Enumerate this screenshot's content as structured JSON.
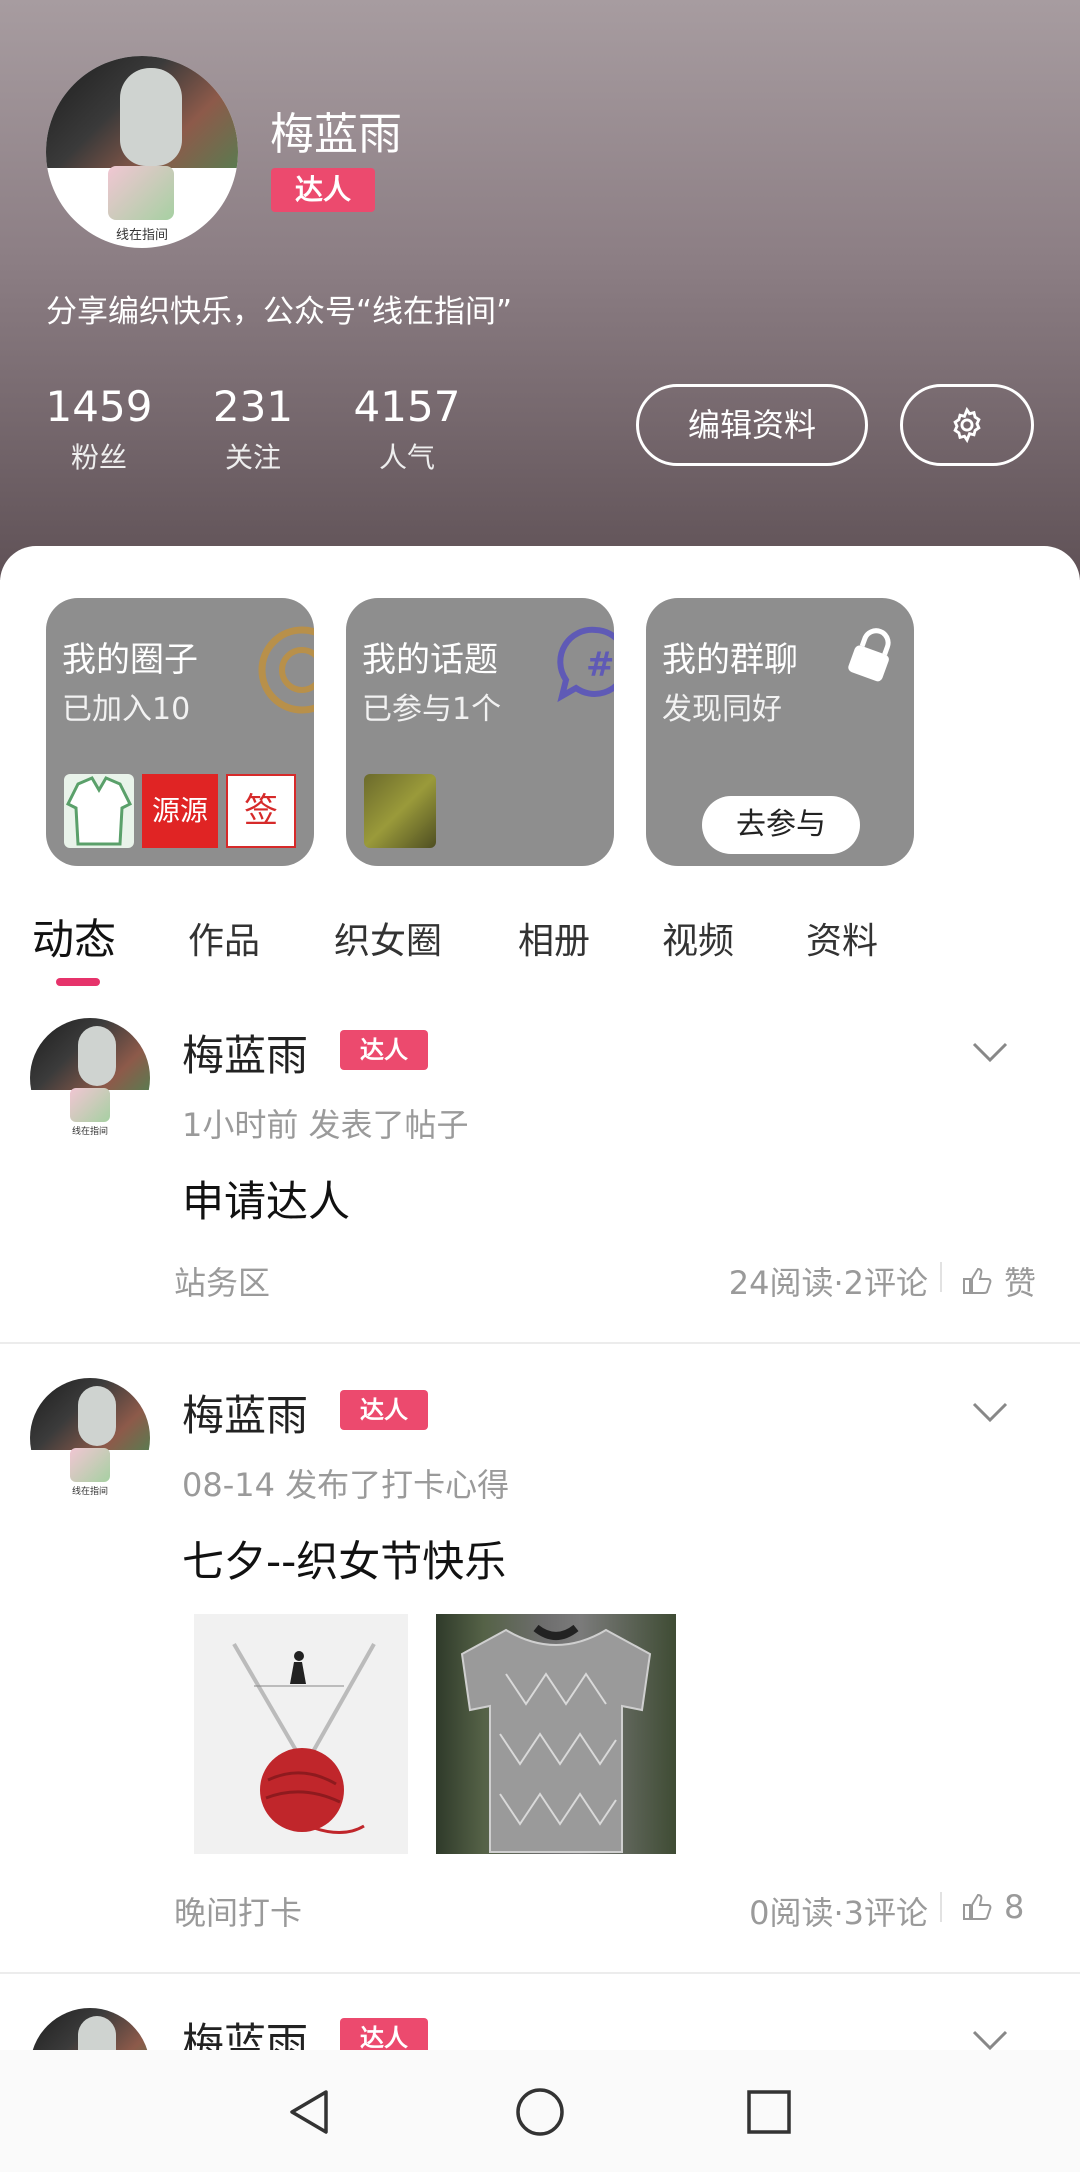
{
  "profile": {
    "name": "梅蓝雨",
    "badge": "达人",
    "avatar_caption": "线在指间",
    "bio": "分享编织快乐，公众号“线在指间”",
    "stats": [
      {
        "value": "1459",
        "label": "粉丝"
      },
      {
        "value": "231",
        "label": "关注"
      },
      {
        "value": "4157",
        "label": "人气"
      }
    ],
    "edit_button": "编辑资料",
    "settings_icon": "gear-icon"
  },
  "cards": [
    {
      "title": "我的圈子",
      "subtitle": "已加入10",
      "icon": "circle-icon",
      "thumb_text": [
        "源源",
        "签"
      ]
    },
    {
      "title": "我的话题",
      "subtitle": "已参与1个",
      "icon": "hashtag-chat-icon"
    },
    {
      "title": "我的群聊",
      "subtitle": "发现同好",
      "icon": "lock-icon",
      "button": "去参与"
    }
  ],
  "tabs": [
    "动态",
    "作品",
    "织女圈",
    "相册",
    "视频",
    "资料"
  ],
  "active_tab": "动态",
  "posts": [
    {
      "author": "梅蓝雨",
      "badge": "达人",
      "meta": "1小时前 发表了帖子",
      "title": "申请达人",
      "category": "站务区",
      "stats": "24阅读·2评论",
      "like_label": "赞"
    },
    {
      "author": "梅蓝雨",
      "badge": "达人",
      "meta": "08-14 发布了打卡心得",
      "title": "七夕--织女节快乐",
      "category": "晚间打卡",
      "stats": "0阅读·3评论",
      "like_label": "8"
    },
    {
      "author": "梅蓝雨",
      "badge": "达人"
    }
  ],
  "nav": [
    "back-icon",
    "home-icon",
    "recents-icon"
  ],
  "colors": {
    "accent": "#e6336b",
    "badge": "#ec4a6e",
    "card_bg": "#8e8e8e"
  }
}
